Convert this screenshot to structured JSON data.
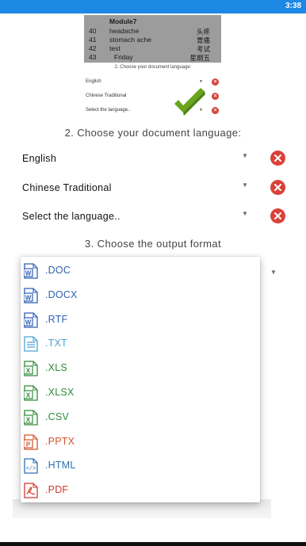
{
  "status_bar": {
    "time": "3:38"
  },
  "preview": {
    "title": "Module7",
    "rows": [
      {
        "num": "40",
        "word": "headache",
        "chinese": "头疼"
      },
      {
        "num": "41",
        "word": "stomach ache",
        "chinese": "胃痛"
      },
      {
        "num": "42",
        "word": "test",
        "chinese": "考试"
      },
      {
        "num": "43",
        "word": "Friday",
        "chinese": "星期五"
      }
    ]
  },
  "thumbnail": {
    "caption": "2. Choose your document language:",
    "rows": [
      "English",
      "Chinese Traditional",
      "Select the language.."
    ]
  },
  "language_section": {
    "heading": "2. Choose your document language:",
    "rows": [
      {
        "label": "English"
      },
      {
        "label": "Chinese Traditional"
      },
      {
        "label": "Select the language.."
      }
    ]
  },
  "output_section": {
    "heading": "3. Choose the output format"
  },
  "format_menu": [
    {
      "ext": ".DOC",
      "icon": "word-file-icon",
      "color": "#2f5fb3"
    },
    {
      "ext": ".DOCX",
      "icon": "word-file-icon",
      "color": "#2f5fb3"
    },
    {
      "ext": ".RTF",
      "icon": "word-file-icon",
      "color": "#2f5fb3"
    },
    {
      "ext": ".TXT",
      "icon": "text-file-icon",
      "color": "#4aa3d6"
    },
    {
      "ext": ".XLS",
      "icon": "excel-file-icon",
      "color": "#2e8b3a"
    },
    {
      "ext": ".XLSX",
      "icon": "excel-file-icon",
      "color": "#2e8b3a"
    },
    {
      "ext": ".CSV",
      "icon": "excel-file-icon",
      "color": "#2e8b3a"
    },
    {
      "ext": ".PPTX",
      "icon": "powerpoint-file-icon",
      "color": "#d2532a"
    },
    {
      "ext": ".HTML",
      "icon": "html-file-icon",
      "color": "#2f6fb3"
    },
    {
      "ext": ".PDF",
      "icon": "pdf-file-icon",
      "color": "#d03a30"
    }
  ],
  "colors": {
    "status_bar": "#1e88e5",
    "remove": "#d9423a",
    "check": "#6aa51e"
  }
}
